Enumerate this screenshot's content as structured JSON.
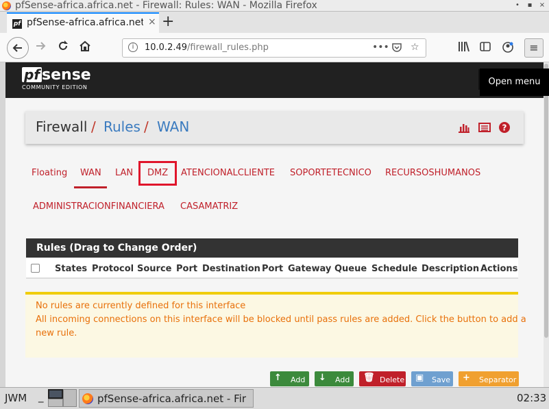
{
  "window": {
    "title": "pfSense-africa.africa.net - Firewall: Rules: WAN - Mozilla Firefox",
    "minimize": "•",
    "maximize": "▪",
    "close": "×"
  },
  "browser": {
    "tab_title": "pfSense-africa.africa.net - Firewall: Rules: WAN",
    "tab_favicon": "pf",
    "tab_close": "×",
    "new_tab": "+",
    "url_host": "10.0.2.49",
    "url_path": "/firewall_rules.php",
    "page_actions": "•••",
    "icons": [
      "back-arrow-icon",
      "forward-arrow-icon",
      "reload-icon",
      "home-icon",
      "site-info-icon",
      "pocket-icon",
      "bookmark-star-icon",
      "library-icon",
      "sidebar-icon",
      "account-icon",
      "hamburger-menu-icon"
    ]
  },
  "pfsense": {
    "logo_pf": "pf",
    "logo_sense": "sense",
    "logo_edition": "COMMUNITY EDITION",
    "nav_tooltip": "Open menu"
  },
  "breadcrumb": {
    "firewall": "Firewall",
    "sep": "/",
    "rules": "Rules",
    "wan": "WAN"
  },
  "rule_tabs": [
    "Floating",
    "WAN",
    "LAN",
    "DMZ",
    "ATENCIONALCLIENTE",
    "SOPORTETECNICO",
    "RECURSOSHUMANOS",
    "ADMINISTRACIONFINANCIERA",
    "CASAMATRIZ"
  ],
  "active_tab": "WAN",
  "highlighted_tab": "DMZ",
  "rules_panel": {
    "heading": "Rules (Drag to Change Order)",
    "columns": [
      "States",
      "Protocol",
      "Source",
      "Port",
      "Destination",
      "Port",
      "Gateway",
      "Queue",
      "Schedule",
      "Description",
      "Actions"
    ]
  },
  "alert": {
    "line1": "No rules are currently defined for this interface",
    "line2": "All incoming connections on this interface will be blocked until pass rules are added. Click the button to add a",
    "line3": "new rule."
  },
  "buttons": [
    {
      "label": "Add",
      "icon": "arrow-up-icon",
      "color": "#3c8a3c"
    },
    {
      "label": "Add",
      "icon": "arrow-down-icon",
      "color": "#3c8a3c"
    },
    {
      "label": "Delete",
      "icon": "trash-icon",
      "color": "#c0202a"
    },
    {
      "label": "Save",
      "icon": "save-icon",
      "color": "#6fa0d0"
    },
    {
      "label": "Separator",
      "icon": "plus-icon",
      "color": "#f0a030"
    }
  ],
  "taskbar": {
    "wm": "JWM",
    "underscore": "_",
    "task_label": "pfSense-africa.africa.net - Fir",
    "clock": "02:33"
  },
  "colors": {
    "accent_red": "#c0202a",
    "link_blue": "#3b7bbf",
    "highlight_box": "#e0152b",
    "alert_text": "#e8700a",
    "alert_border": "#f0cd0c"
  }
}
